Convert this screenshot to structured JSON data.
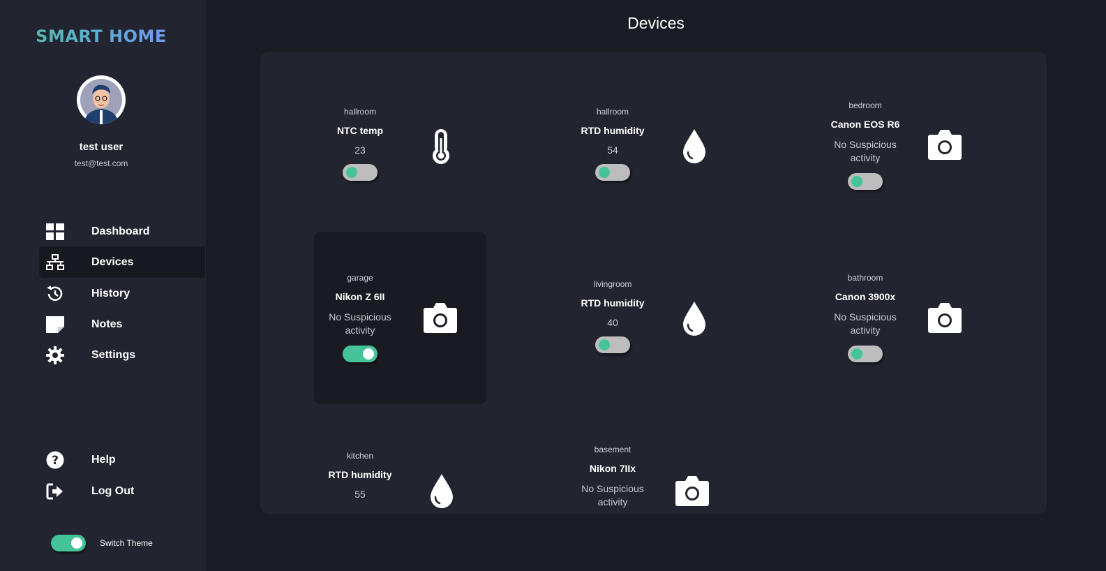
{
  "brand": "SMART HOME",
  "user": {
    "name": "test user",
    "email": "test@test.com"
  },
  "nav": {
    "items": [
      {
        "label": "Dashboard",
        "icon": "grid-icon"
      },
      {
        "label": "Devices",
        "icon": "network-icon",
        "active": true
      },
      {
        "label": "History",
        "icon": "history-icon"
      },
      {
        "label": "Notes",
        "icon": "note-icon"
      },
      {
        "label": "Settings",
        "icon": "gear-icon"
      }
    ],
    "bottom": [
      {
        "label": "Help",
        "icon": "help-icon"
      },
      {
        "label": "Log Out",
        "icon": "logout-icon"
      }
    ]
  },
  "theme": {
    "label": "Switch Theme",
    "on": true
  },
  "page": {
    "title": "Devices"
  },
  "devices": [
    {
      "room": "hallroom",
      "name": "NTC temp",
      "value": "23",
      "icon": "thermometer-icon",
      "on": false
    },
    {
      "room": "hallroom",
      "name": "RTD humidity",
      "value": "54",
      "icon": "droplet-icon",
      "on": false
    },
    {
      "room": "bedroom",
      "name": "Canon EOS R6",
      "status": "No Suspicious activity",
      "icon": "camera-icon",
      "on": false
    },
    {
      "room": "garage",
      "name": "Nikon Z 6II",
      "status": "No Suspicious activity",
      "icon": "camera-icon",
      "on": true,
      "highlighted": true
    },
    {
      "room": "livingroom",
      "name": "RTD humidity",
      "value": "40",
      "icon": "droplet-icon",
      "on": false
    },
    {
      "room": "bathroom",
      "name": "Canon 3900x",
      "status": "No Suspicious activity",
      "icon": "camera-icon",
      "on": false
    },
    {
      "room": "kitchen",
      "name": "RTD humidity",
      "value": "55",
      "icon": "droplet-icon",
      "on": false
    },
    {
      "room": "basement",
      "name": "Nikon 7IIx",
      "status": "No Suspicious activity",
      "icon": "camera-icon",
      "on": false
    }
  ],
  "colors": {
    "accent": "#45c49a",
    "sidebar": "#22242f",
    "background": "#1b1c23",
    "card_highlight": "#1a1b22"
  }
}
